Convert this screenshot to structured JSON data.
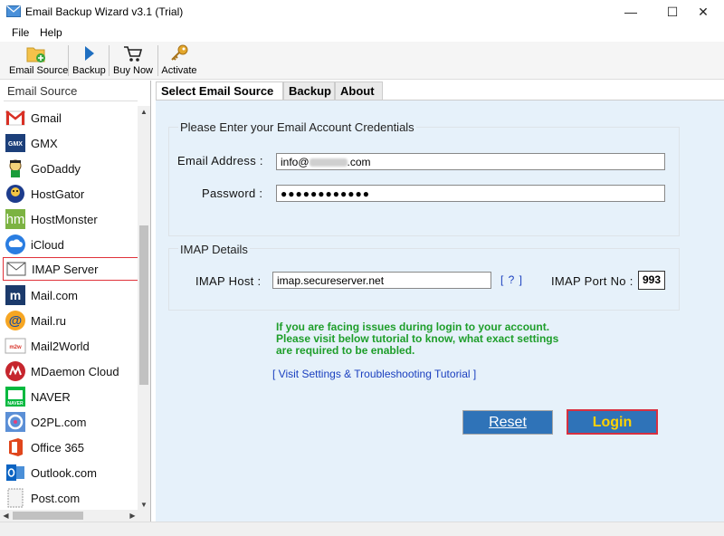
{
  "window": {
    "title": "Email Backup Wizard v3.1 (Trial)",
    "controls": {
      "minimize": "—",
      "maximize": "☐",
      "close": "✕"
    }
  },
  "menu": [
    "File",
    "Help"
  ],
  "toolbar": {
    "email_source": "Email Source",
    "backup": "Backup",
    "buy_now": "Buy Now",
    "activate": "Activate"
  },
  "sidebar": {
    "title": "Email Source",
    "items": [
      {
        "label": "Gmail",
        "icon": "gmail-icon"
      },
      {
        "label": "GMX",
        "icon": "gmx-icon"
      },
      {
        "label": "GoDaddy",
        "icon": "godaddy-icon"
      },
      {
        "label": "HostGator",
        "icon": "hostgator-icon"
      },
      {
        "label": "HostMonster",
        "icon": "hostmonster-icon"
      },
      {
        "label": "iCloud",
        "icon": "icloud-icon"
      },
      {
        "label": "IMAP Server",
        "icon": "imap-envelope-icon",
        "selected": true
      },
      {
        "label": "Mail.com",
        "icon": "mailcom-icon"
      },
      {
        "label": "Mail.ru",
        "icon": "mailru-icon"
      },
      {
        "label": "Mail2World",
        "icon": "mail2world-icon"
      },
      {
        "label": "MDaemon Cloud",
        "icon": "mdaemon-icon"
      },
      {
        "label": "NAVER",
        "icon": "naver-icon"
      },
      {
        "label": "O2PL.com",
        "icon": "o2pl-icon"
      },
      {
        "label": "Office 365",
        "icon": "office365-icon"
      },
      {
        "label": "Outlook.com",
        "icon": "outlook-icon"
      },
      {
        "label": "Post.com",
        "icon": "postcom-icon"
      }
    ]
  },
  "tabs": [
    "Select Email Source",
    "Backup",
    "About"
  ],
  "credentials": {
    "title": "Please Enter your Email Account Credentials",
    "email_label": "Email Address :",
    "email_prefix": "info@",
    "email_suffix": ".com",
    "password_label": "Password :",
    "password_value": "●●●●●●●●●●●●"
  },
  "imap": {
    "title": "IMAP Details",
    "host_label": "IMAP Host :",
    "host_value": "imap.secureserver.net",
    "help": "[ ? ]",
    "port_label": "IMAP Port No :",
    "port_value": "993"
  },
  "notice": {
    "line1": "If you are facing issues during login to your account.",
    "line2": "Please visit below tutorial to know, what exact settings",
    "line3": "are required to be enabled."
  },
  "tutorial_link": "[ Visit Settings & Troubleshooting Tutorial ]",
  "buttons": {
    "reset": "Reset",
    "login": "Login"
  },
  "colors": {
    "panel_bg": "#e6f1fa",
    "button_blue": "#2f73b8",
    "login_text": "#ffd200",
    "notice_green": "#1e9e2a",
    "link_blue": "#1a3fbf",
    "selected_border": "#e0323a"
  }
}
